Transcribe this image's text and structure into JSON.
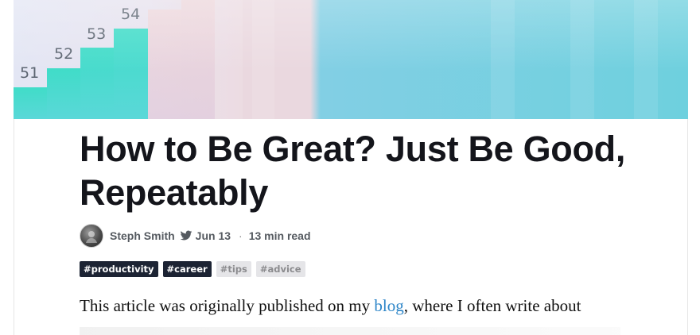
{
  "cover": {
    "bars": [
      {
        "label": "51",
        "visible_label": true
      },
      {
        "label": "52",
        "visible_label": true
      },
      {
        "label": "53",
        "visible_label": true
      },
      {
        "label": "54",
        "visible_label": true
      }
    ],
    "colors": {
      "bar": "#40dcc8",
      "left_bg": "#e3e6f4",
      "right_bg": "#6ed0de"
    }
  },
  "article": {
    "title": "How to Be Great? Just Be Good, Repeatably",
    "author": "Steph Smith",
    "date": "Jun 13",
    "separator": "·",
    "read_time": "13 min read",
    "tags": [
      {
        "label": "#productivity",
        "style": "dark"
      },
      {
        "label": "#career",
        "style": "dark"
      },
      {
        "label": "#tips",
        "style": "light"
      },
      {
        "label": "#advice",
        "style": "light"
      }
    ],
    "intro_before_link": "This article was originally published on my ",
    "intro_link": "blog",
    "intro_after_link": ", where I often write about"
  },
  "icons": {
    "avatar": "author-avatar",
    "bird": "twitter-icon"
  },
  "colors": {
    "title": "#14151b",
    "link": "#2e86c8",
    "tag_dark": "#1c2333",
    "tag_light": "#e5e5e8"
  }
}
